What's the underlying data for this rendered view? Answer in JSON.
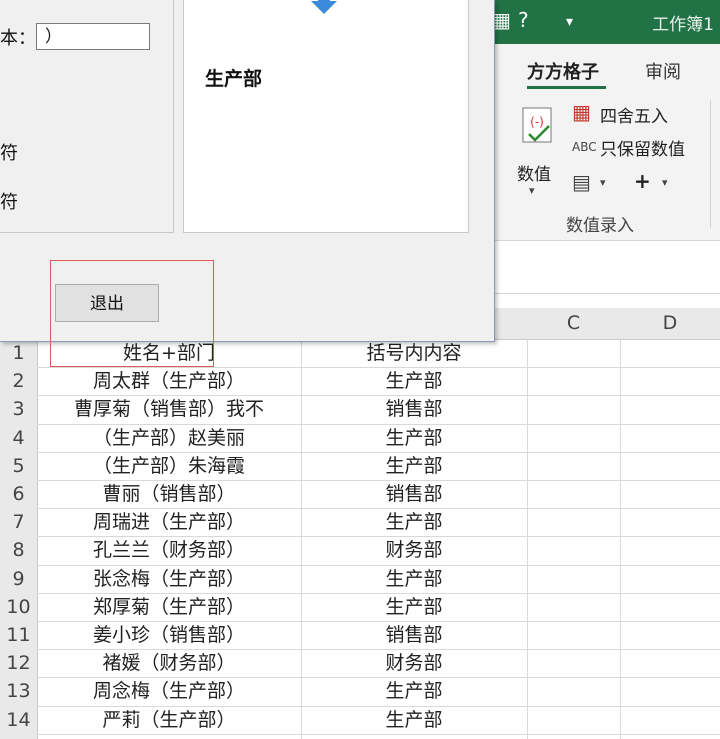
{
  "excel": {
    "title": "工作簿1",
    "tabs": [
      {
        "label": "方方格子",
        "active": true
      },
      {
        "label": "审阅",
        "active": false
      }
    ],
    "ribbon": {
      "numeric_label": "数值",
      "round_label": "四舍五入",
      "keep_numeric_label": "只保留数值",
      "abc_icon_text": "ABC",
      "group_label": "数值录入",
      "plus_symbol": "+"
    },
    "accent_color": "#217346"
  },
  "dialog": {
    "text_label": "本：",
    "input_value": "）",
    "option1": "符",
    "option2": "符",
    "preview_text": "生产部",
    "exit_button": "退出",
    "highlight_color": "#e05a5a"
  },
  "sheet": {
    "columns": [
      "C",
      "D"
    ],
    "row_numbers": [
      "1",
      "2",
      "3",
      "4",
      "5",
      "6",
      "7",
      "8",
      "9",
      "10",
      "11",
      "12",
      "13",
      "14"
    ],
    "rows": [
      [
        "姓名+部门",
        "括号内内容"
      ],
      [
        "周太群（生产部）",
        "生产部"
      ],
      [
        "曹厚菊（销售部）我不",
        "销售部"
      ],
      [
        "（生产部）赵美丽",
        "生产部"
      ],
      [
        "（生产部）朱海霞",
        "生产部"
      ],
      [
        "曹丽（销售部）",
        "销售部"
      ],
      [
        "周瑞进（生产部）",
        "生产部"
      ],
      [
        "孔兰兰（财务部）",
        "财务部"
      ],
      [
        "张念梅（生产部）",
        "生产部"
      ],
      [
        "郑厚菊（生产部）",
        "生产部"
      ],
      [
        "姜小珍（销售部）",
        "销售部"
      ],
      [
        "褚媛（财务部）",
        "财务部"
      ],
      [
        "周念梅（生产部）",
        "生产部"
      ],
      [
        "严莉（生产部）",
        "生产部"
      ]
    ]
  }
}
